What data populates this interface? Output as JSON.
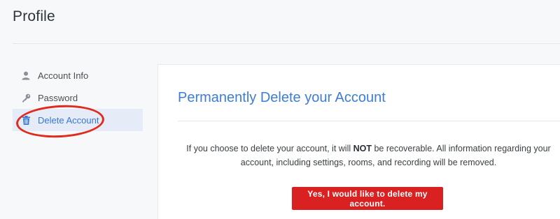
{
  "header": {
    "title": "Profile"
  },
  "sidebar": {
    "items": [
      {
        "label": "Account Info",
        "icon": "user-icon",
        "active": false
      },
      {
        "label": "Password",
        "icon": "key-icon",
        "active": false
      },
      {
        "label": "Delete Account",
        "icon": "trash-icon",
        "active": true
      }
    ]
  },
  "main": {
    "title": "Permanently Delete your Account",
    "warning": {
      "before": "If you choose to delete your account, it will ",
      "emphasis": "NOT",
      "after": " be recoverable. All information regarding your account, including settings, rooms, and recording will be removed."
    },
    "delete_button_label": "Yes, I would like to delete my account."
  },
  "colors": {
    "accent": "#3677d6",
    "danger": "#d92121",
    "annotation": "#e02a1d"
  }
}
